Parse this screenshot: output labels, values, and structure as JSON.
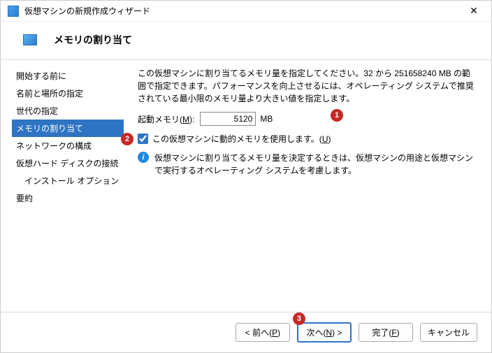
{
  "window": {
    "title": "仮想マシンの新規作成ウィザード"
  },
  "header": {
    "title": "メモリの割り当て"
  },
  "sidebar": {
    "steps": [
      "開始する前に",
      "名前と場所の指定",
      "世代の指定",
      "メモリの割り当て",
      "ネットワークの構成",
      "仮想ハード ディスクの接続",
      "インストール オプション",
      "要約"
    ]
  },
  "main": {
    "desc": "この仮想マシンに割り当てるメモリ量を指定してください。32 から 251658240 MB の範囲で指定できます。パフォーマンスを向上させるには、オペレーティング システムで推奨されている最小限のメモリ量より大きい値を指定します。",
    "mem_label_pre": "起動メモリ(",
    "mem_label_u": "M",
    "mem_label_post": "):",
    "mem_value": "5120",
    "mem_unit": "MB",
    "dyn_pre": "この仮想マシンに動的メモリを使用します。(",
    "dyn_u": "U",
    "dyn_post": ")",
    "info": "仮想マシンに割り当てるメモリ量を決定するときは、仮想マシンの用途と仮想マシンで実行するオペレーティング システムを考慮します。"
  },
  "footer": {
    "prev_pre": "< 前へ(",
    "prev_u": "P",
    "prev_post": ")",
    "next_pre": "次へ(",
    "next_u": "N",
    "next_post": ") >",
    "finish_pre": "完了(",
    "finish_u": "F",
    "finish_post": ")",
    "cancel": "キャンセル"
  },
  "badges": {
    "b1": "1",
    "b2": "2",
    "b3": "3"
  }
}
